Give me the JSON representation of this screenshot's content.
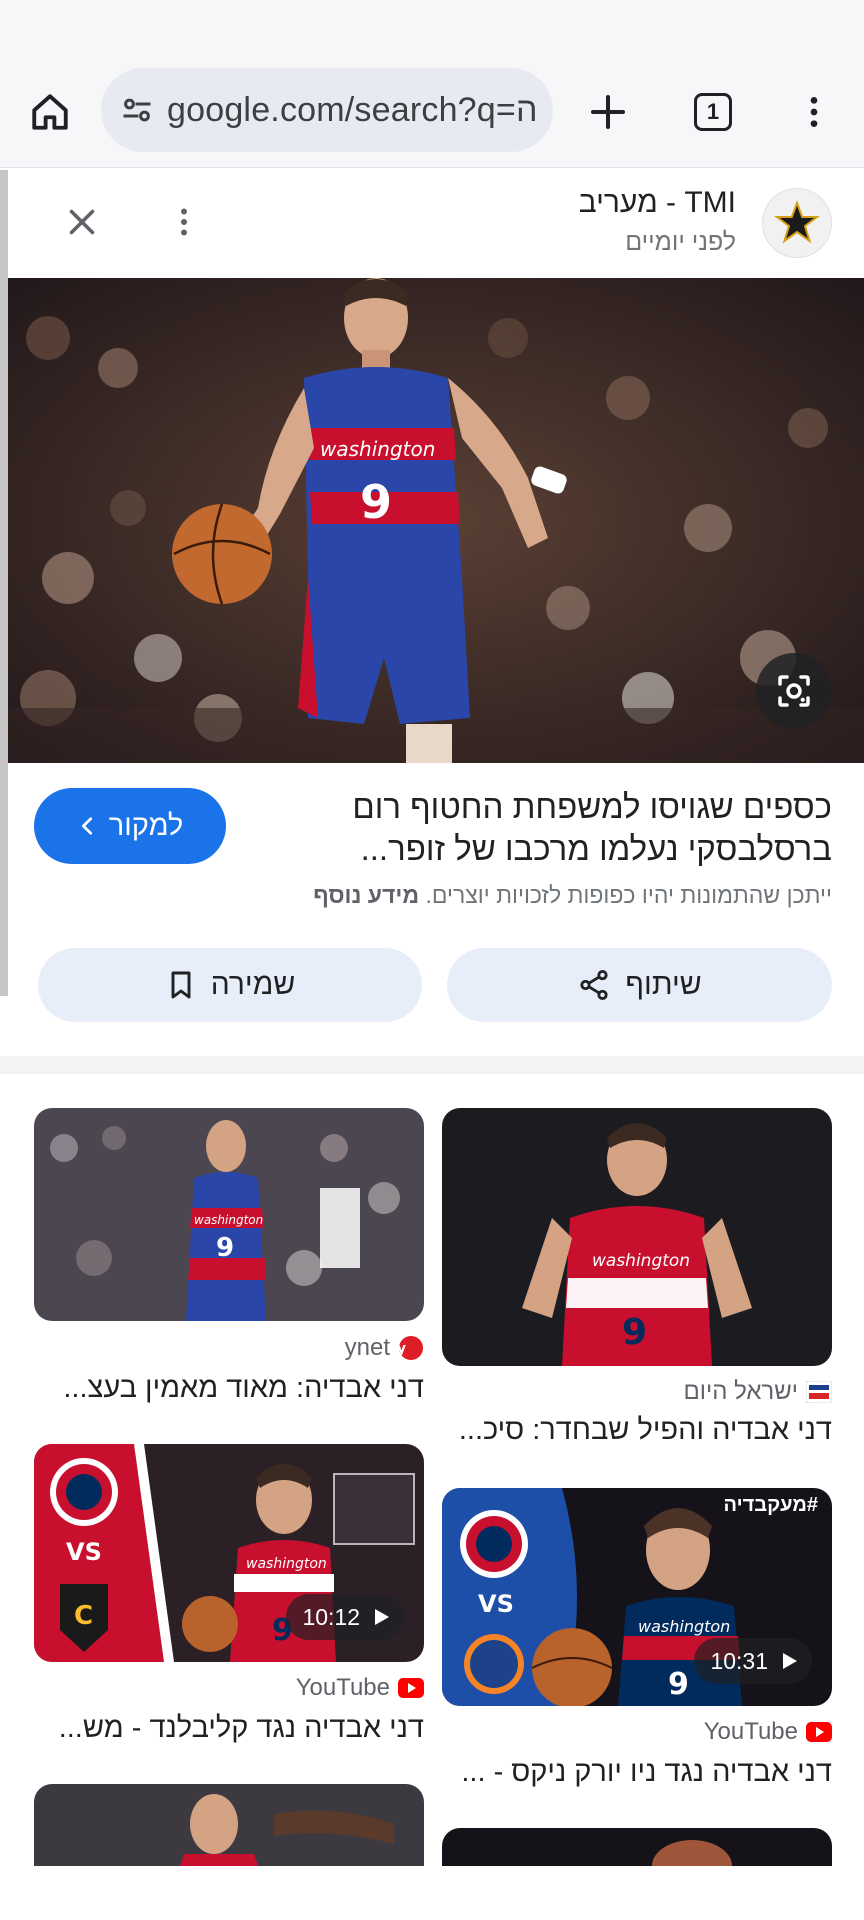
{
  "browser": {
    "url": "google.com/search?q=ה",
    "tab_count": "1"
  },
  "source": {
    "title": "TMI - מעריב",
    "time": "לפני יומיים"
  },
  "result": {
    "title": "כספים שגויסו למשפחת החטוף רום ברסלבסקי נעלמו מרכבו של זופר...",
    "source_button": "למקור",
    "rights_note": "ייתכן שהתמונות יהיו כפופות לזכויות יוצרים.",
    "rights_link": "מידע נוסף",
    "share_label": "שיתוף",
    "save_label": "שמירה"
  },
  "grid": [
    {
      "source": "ישראל היום",
      "title": "דני אבדיה והפיל שבחדר: סיכ...",
      "icon": "israel-hayom-icon",
      "duration": ""
    },
    {
      "source": "ynet",
      "title": "דני אבדיה: מאוד מאמין בעצ...",
      "icon": "ynet-icon",
      "duration": ""
    },
    {
      "source": "YouTube",
      "title": "דני אבדיה נגד ניו יורק ניקס - ...",
      "icon": "youtube-icon",
      "duration": "10:31",
      "overlay": "#מעקבדיה"
    },
    {
      "source": "YouTube",
      "title": "דני אבדיה נגד קליבלנד - מש...",
      "icon": "youtube-icon",
      "duration": "10:12"
    }
  ],
  "colors": {
    "accent": "#1a73e8",
    "chip_bg": "#e8eef9",
    "wizards_red": "#c8102e",
    "wizards_navy": "#002b5c",
    "youtube_red": "#ff0000"
  }
}
